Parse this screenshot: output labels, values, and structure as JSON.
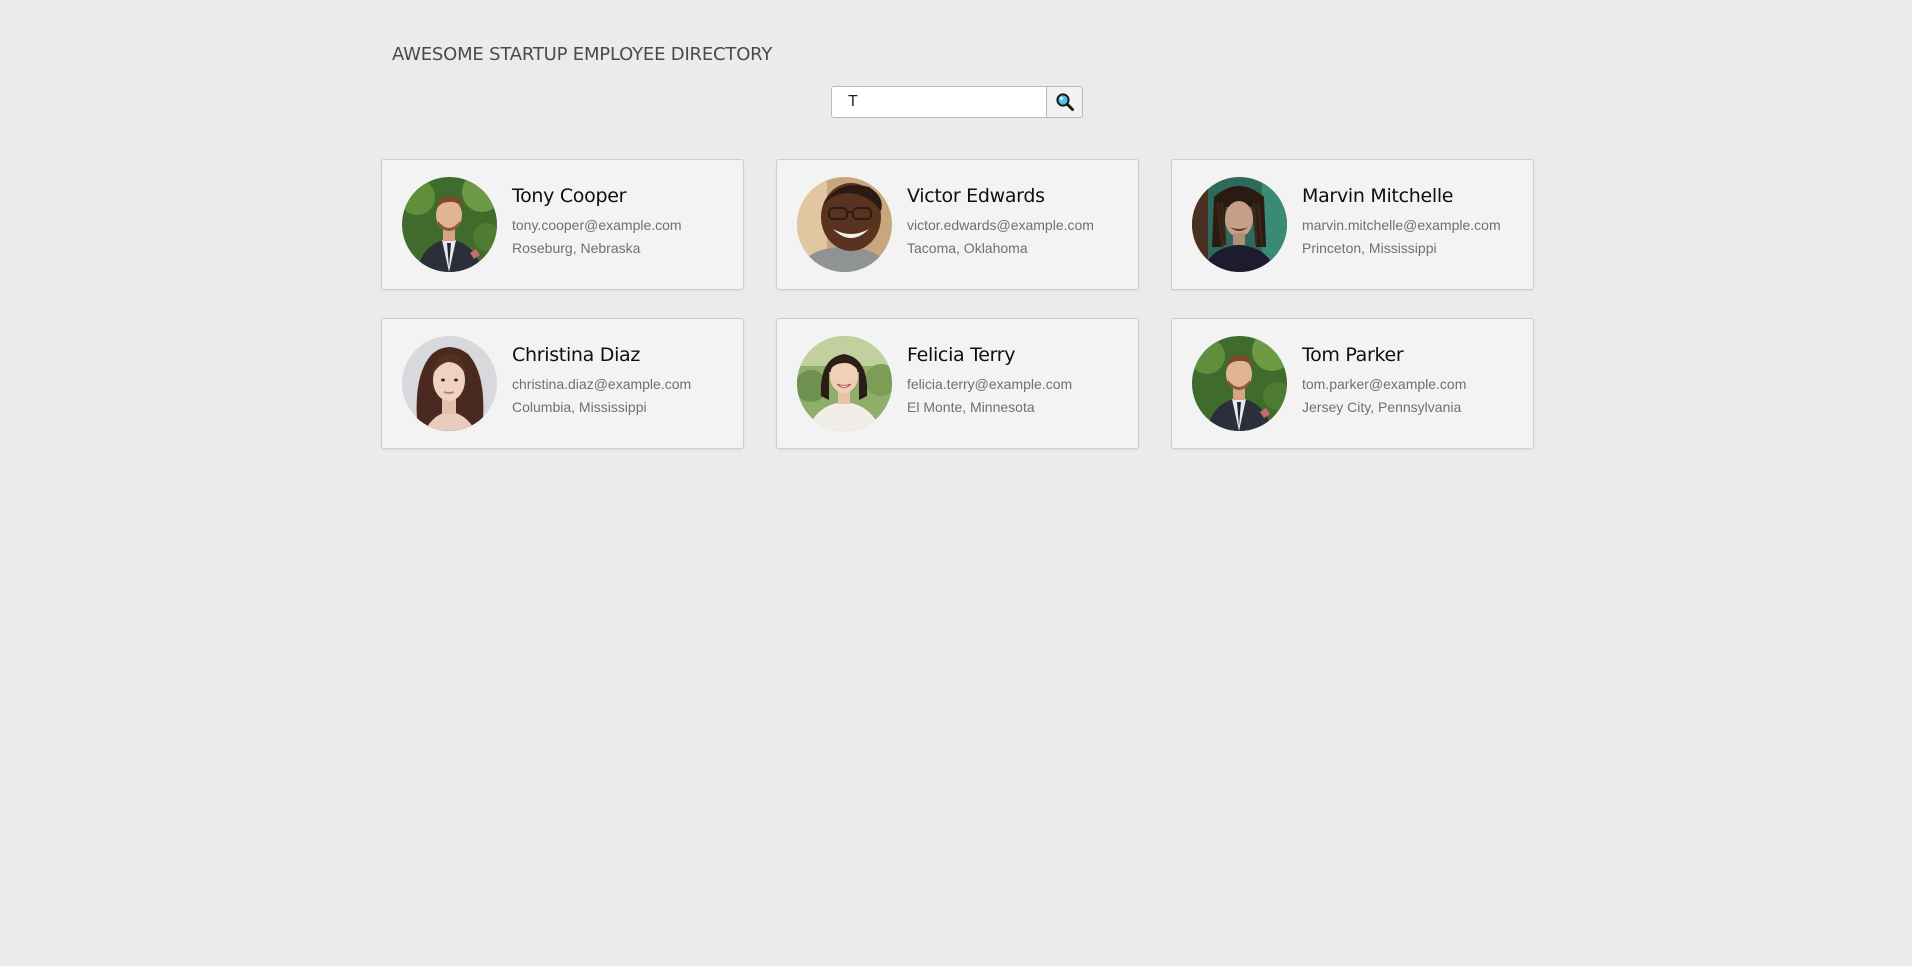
{
  "header": {
    "title": "AWESOME STARTUP EMPLOYEE DIRECTORY"
  },
  "search": {
    "value": "T",
    "submit_icon": "magnifier-icon"
  },
  "employees": [
    {
      "name": "Tony Cooper",
      "email": "tony.cooper@example.com",
      "location": "Roseburg, Nebraska"
    },
    {
      "name": "Victor Edwards",
      "email": "victor.edwards@example.com",
      "location": "Tacoma, Oklahoma"
    },
    {
      "name": "Marvin Mitchelle",
      "email": "marvin.mitchelle@example.com",
      "location": "Princeton, Mississippi"
    },
    {
      "name": "Christina Diaz",
      "email": "christina.diaz@example.com",
      "location": "Columbia, Mississippi"
    },
    {
      "name": "Felicia Terry",
      "email": "felicia.terry@example.com",
      "location": "El Monte, Minnesota"
    },
    {
      "name": "Tom Parker",
      "email": "tom.parker@example.com",
      "location": "Jersey City, Pennsylvania"
    }
  ],
  "colors": {
    "background": "#ebebeb",
    "card": "#f3f3f3",
    "card_border": "#cdcdcd",
    "title": "#4a4a4a",
    "secondary_text": "#707070",
    "search_icon_lens": "#4fc3e8"
  }
}
